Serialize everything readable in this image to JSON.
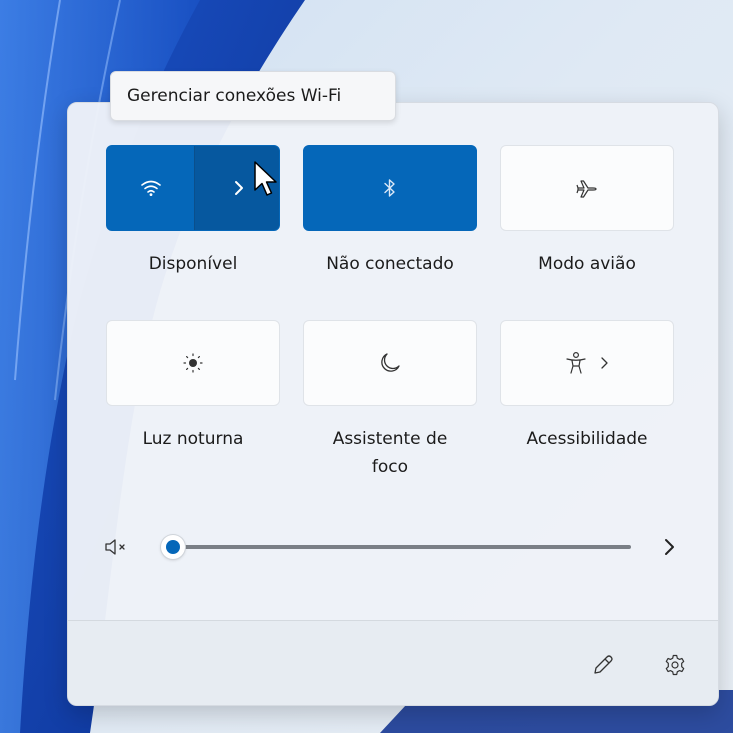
{
  "tooltip": {
    "text": "Gerenciar conexões Wi-Fi"
  },
  "tiles": [
    {
      "id": "wifi",
      "label": "Disponível",
      "state": "on",
      "icon": "wifi-icon",
      "has_chevron": true
    },
    {
      "id": "bluetooth",
      "label": "Não conectado",
      "state": "on",
      "icon": "bluetooth-icon",
      "has_chevron": false
    },
    {
      "id": "airplane",
      "label": "Modo avião",
      "state": "off",
      "icon": "airplane-icon",
      "has_chevron": false
    },
    {
      "id": "night-light",
      "label": "Luz noturna",
      "state": "off",
      "icon": "brightness-icon",
      "has_chevron": false
    },
    {
      "id": "focus",
      "label_line1": "Assistente de",
      "label_line2": "foco",
      "state": "off",
      "icon": "moon-icon",
      "has_chevron": false
    },
    {
      "id": "accessibility",
      "label": "Acessibilidade",
      "state": "off",
      "icon": "accessibility-icon",
      "has_chevron": true
    }
  ],
  "volume": {
    "muted": true,
    "level": 0,
    "mute_icon": "speaker-muted-icon",
    "chevron_icon": "chevron-right-icon"
  },
  "footer": {
    "edit_icon": "pencil-icon",
    "settings_icon": "gear-icon"
  },
  "colors": {
    "accent": "#0567b9",
    "accent_dark": "#06589f",
    "tile_off": "#fbfcfd",
    "panel": "#eef2f8"
  }
}
